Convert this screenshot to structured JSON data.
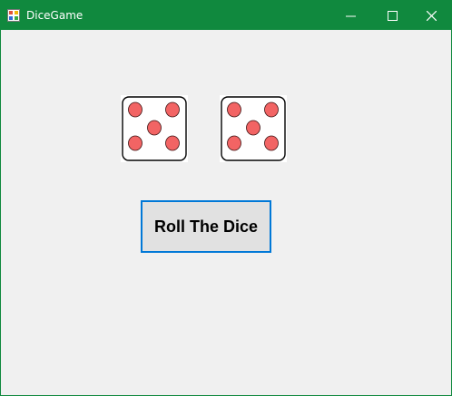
{
  "window": {
    "title": "DiceGame",
    "titlebar_color": "#10893e",
    "controls": {
      "minimize_icon": "minimize-icon",
      "maximize_icon": "maximize-icon",
      "close_icon": "close-icon"
    }
  },
  "dice": [
    {
      "value": 5,
      "pip_color": "#f26464"
    },
    {
      "value": 5,
      "pip_color": "#f26464"
    }
  ],
  "roll_button": {
    "label": "Roll The Dice",
    "accent": "#0078d7"
  }
}
